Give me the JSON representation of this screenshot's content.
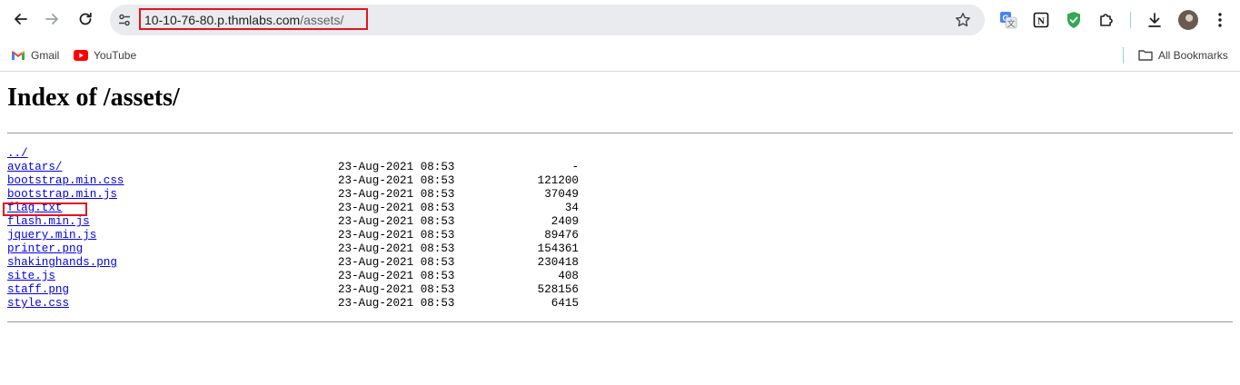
{
  "browser": {
    "url_host": "10-10-76-80.p.thmlabs.com",
    "url_path": "/assets/",
    "icons": {
      "back": "back-arrow-icon",
      "forward": "forward-arrow-icon",
      "reload": "reload-icon",
      "site_info": "tune-icon",
      "bookmark_star": "star-icon",
      "extensions": [
        "google-translate-icon",
        "notion-icon",
        "shield-check-icon",
        "puzzle-extensions-icon"
      ],
      "download": "download-icon",
      "menu": "three-dots-menu-icon"
    },
    "annotation_color": "#e0161b"
  },
  "bookmarks": {
    "items": [
      {
        "label": "Gmail",
        "icon": "gmail-icon"
      },
      {
        "label": "YouTube",
        "icon": "youtube-icon"
      }
    ],
    "all_bookmarks": {
      "label": "All Bookmarks",
      "icon": "folder-icon"
    }
  },
  "page": {
    "title": "Index of /assets/",
    "parent_link": "../",
    "entries": [
      {
        "name": "avatars/",
        "date": "23-Aug-2021 08:53",
        "size": "-"
      },
      {
        "name": "bootstrap.min.css",
        "date": "23-Aug-2021 08:53",
        "size": "121200"
      },
      {
        "name": "bootstrap.min.js",
        "date": "23-Aug-2021 08:53",
        "size": "37049"
      },
      {
        "name": "flag.txt",
        "date": "23-Aug-2021 08:53",
        "size": "34"
      },
      {
        "name": "flash.min.js",
        "date": "23-Aug-2021 08:53",
        "size": "2409"
      },
      {
        "name": "jquery.min.js",
        "date": "23-Aug-2021 08:53",
        "size": "89476"
      },
      {
        "name": "printer.png",
        "date": "23-Aug-2021 08:53",
        "size": "154361"
      },
      {
        "name": "shakinghands.png",
        "date": "23-Aug-2021 08:53",
        "size": "230418"
      },
      {
        "name": "site.js",
        "date": "23-Aug-2021 08:53",
        "size": "408"
      },
      {
        "name": "staff.png",
        "date": "23-Aug-2021 08:53",
        "size": "528156"
      },
      {
        "name": "style.css",
        "date": "23-Aug-2021 08:53",
        "size": "6415"
      }
    ]
  }
}
